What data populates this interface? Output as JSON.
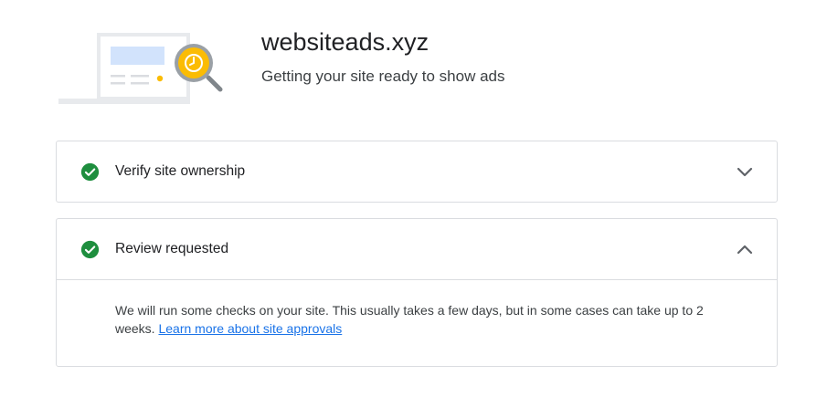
{
  "header": {
    "site_name": "websiteads.xyz",
    "subtitle": "Getting your site ready to show ads",
    "illustration_icon": "laptop-with-magnifier-clock-icon"
  },
  "steps": [
    {
      "title": "Verify site ownership",
      "status": "complete",
      "status_icon": "check-circle-icon",
      "expanded": false,
      "toggle_icon": "chevron-down-icon"
    },
    {
      "title": "Review requested",
      "status": "complete",
      "status_icon": "check-circle-icon",
      "expanded": true,
      "toggle_icon": "chevron-up-icon",
      "body_text": "We will run some checks on your site. This usually takes a few days, but in some cases can take up to 2 weeks.",
      "link_text": "Learn more about site approvals"
    }
  ],
  "colors": {
    "success_green": "#1e8e3e",
    "link_blue": "#1a73e8",
    "card_border": "#dadce0",
    "accent_yellow": "#fbbc04"
  }
}
